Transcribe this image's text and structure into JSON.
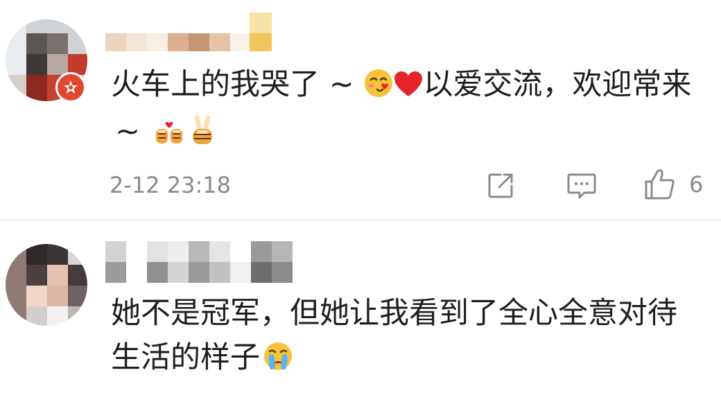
{
  "comments": [
    {
      "text_line1": "火车上的我哭了 ~",
      "text_heart_after": "以爱交流，欢迎常来",
      "text_line2": "~",
      "emoji": [
        "face-blowing-kiss-emoji",
        "red-heart-emoji",
        "tiger-heart-hands-emoji",
        "tiger-victory-hand-emoji"
      ],
      "timestamp": "2-12 23:18",
      "likes": "6"
    },
    {
      "text_line1": "她不是冠军，但她让我看到了全心全意对待",
      "text_line2": "生活的样子",
      "emoji": [
        "crying-face-emoji"
      ]
    }
  ],
  "colors": {
    "text": "#1e1e1e",
    "meta": "#8a8a8a",
    "badge": "#e0492f",
    "divider": "#efefef"
  }
}
